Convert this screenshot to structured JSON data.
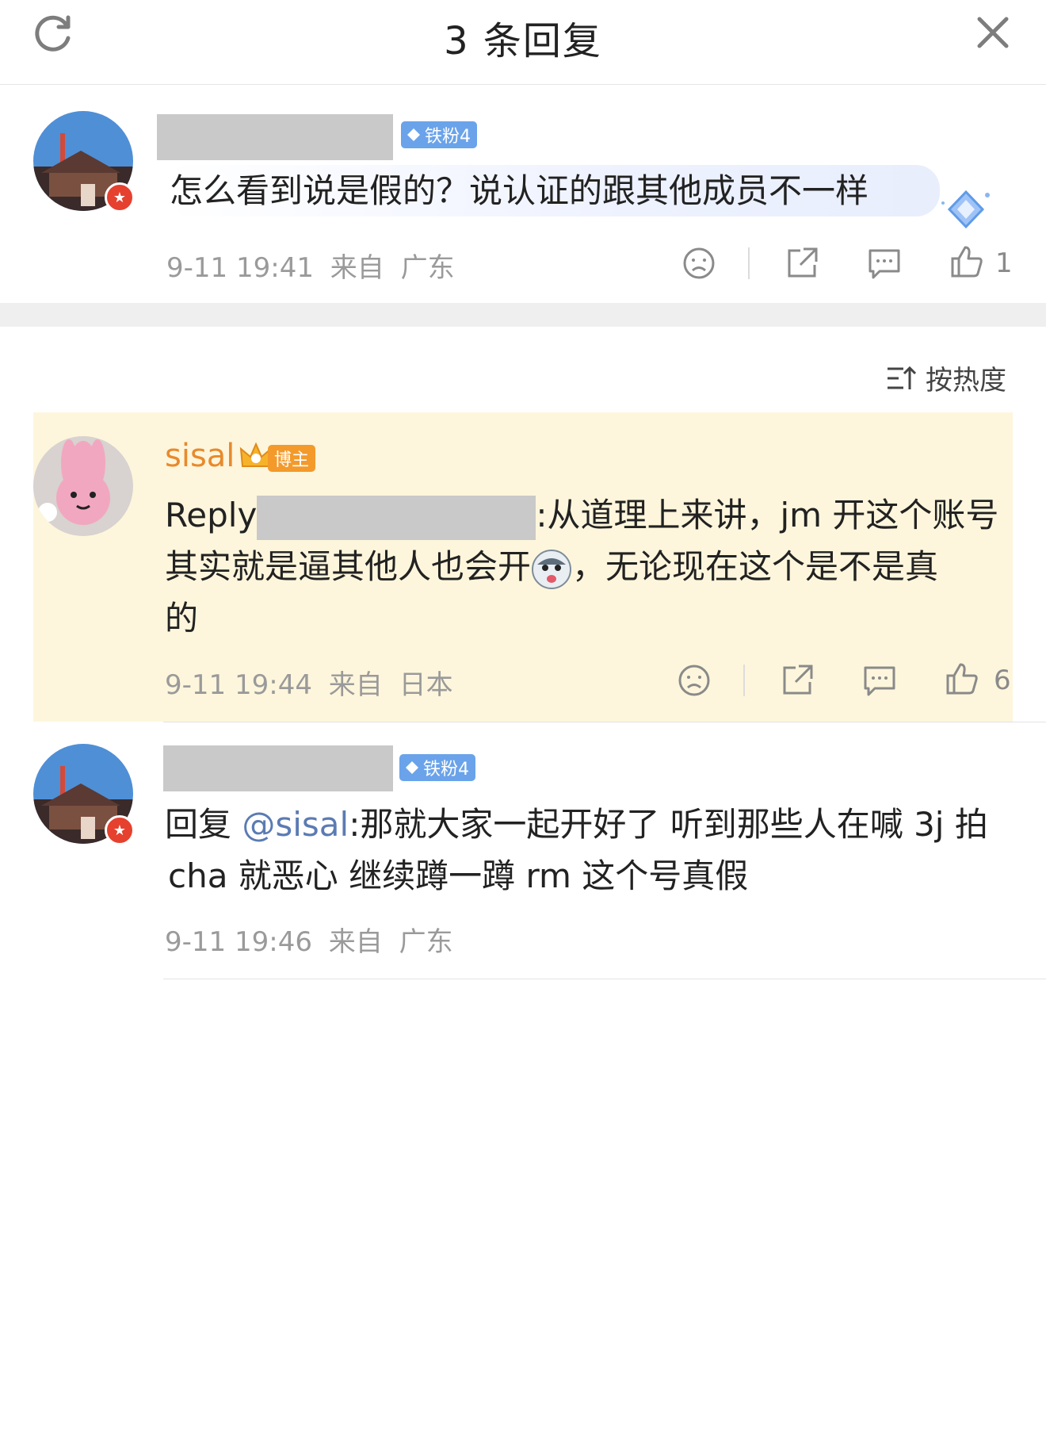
{
  "header": {
    "title": "3 条回复",
    "refresh_icon": "refresh-icon",
    "close_icon": "close-icon"
  },
  "comment1": {
    "fan_badge": "铁粉4",
    "text": "怎么看到说是假的？说认证的跟其他成员不一样",
    "time": "9-11 19:41",
    "from": "来自",
    "location": "广东",
    "like_count": "1"
  },
  "sort": {
    "label": "按热度"
  },
  "comment2": {
    "name": "sisal",
    "blogger_badge": "博主",
    "reply_prefix": "Reply",
    "line1_rest": ":从道理上来讲，jm 开这个账号",
    "line2_a": "其实就是逼其他人也会开",
    "line2_b": "，无论现在这个是不是真",
    "line3": "的",
    "time": "9-11 19:44",
    "from": "来自",
    "location": "日本",
    "like_count": "6"
  },
  "comment3": {
    "fan_badge": "铁粉4",
    "reply_word": "回复",
    "mention": "@sisal",
    "line1_rest": ":那就大家一起开好了 听到那些人在喊 3j 拍",
    "line2": "cha 就恶心 继续蹲一蹲 rm 这个号真假",
    "time": "9-11 19:46",
    "from": "来自",
    "location": "广东"
  },
  "colors": {
    "accent_name": "#e88a2c",
    "mention": "#5b7bb3",
    "highlight_bg": "#fdf6dc",
    "fan_badge": "#6aa3ea"
  }
}
